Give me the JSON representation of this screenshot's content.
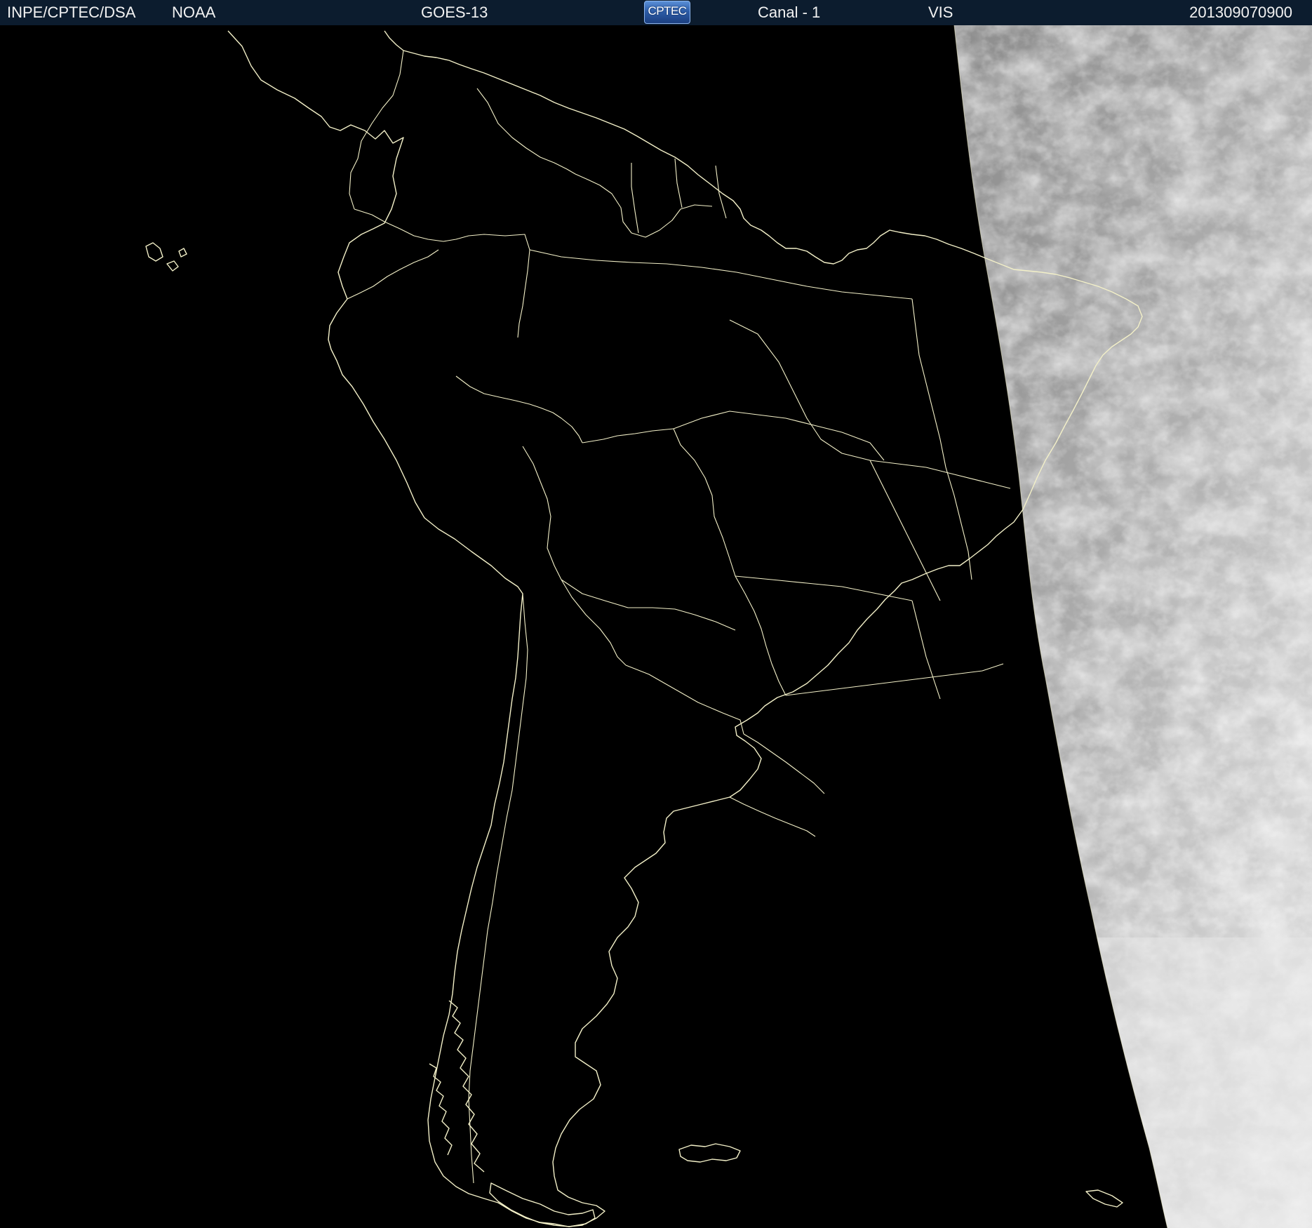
{
  "header": {
    "source": "INPE/CPTEC/DSA",
    "agency": "NOAA",
    "satellite": "GOES-13",
    "logo_text": "CPTEC",
    "channel": "Canal - 1",
    "band": "VIS",
    "timestamp": "201309070900"
  },
  "map": {
    "region": "South America",
    "imagery": "visible-satellite",
    "overlay_color": "#f3f0c8",
    "background_color": "#000000"
  },
  "colors": {
    "header_bg": "#0c1c2e",
    "header_text": "#f2f2f2",
    "logo_blue": "#2d5da8"
  }
}
